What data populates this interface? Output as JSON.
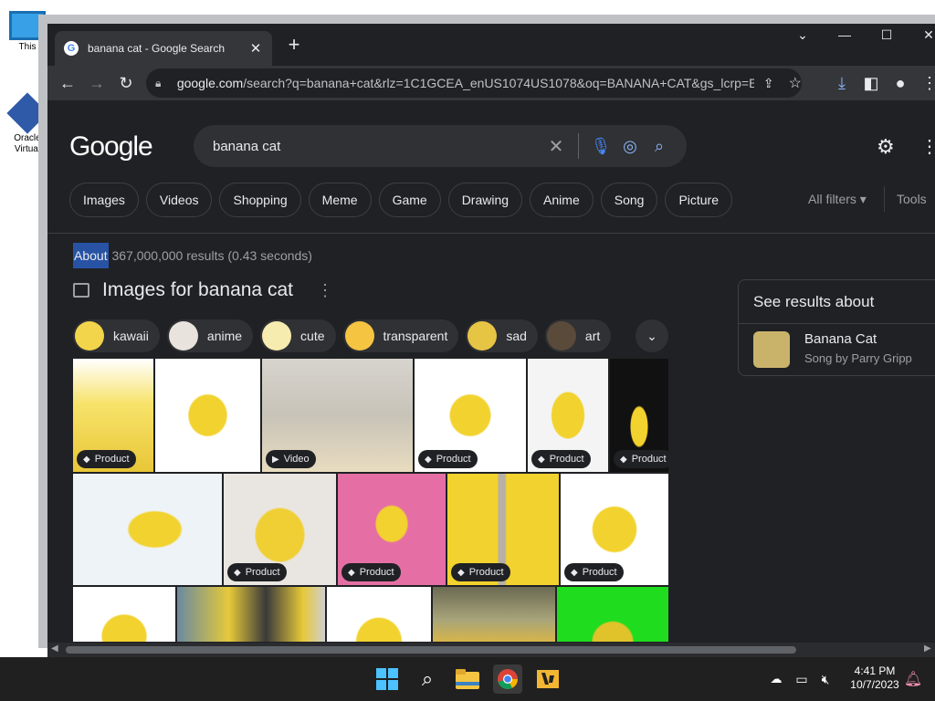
{
  "desktop": {
    "icons": [
      {
        "label": "This"
      },
      {
        "label": "Oracle Virtual"
      }
    ]
  },
  "browser": {
    "tab": {
      "title": "banana cat - Google Search",
      "close": "✕"
    },
    "new_tab": "+",
    "window_controls": {
      "tabsearch": "⌄",
      "minimize": "—",
      "maximize": "☐",
      "close": "✕"
    },
    "url_domain": "google.com",
    "url_path": "/search?q=banana+cat&rlz=1C1GCEA_enUS1074US1078&oq=BANANA+CAT&gs_lcrp=E..."
  },
  "google": {
    "logo": "Google",
    "query": "banana cat",
    "chips": [
      "Images",
      "Videos",
      "Shopping",
      "Meme",
      "Game",
      "Drawing",
      "Anime",
      "Song",
      "Picture"
    ],
    "all_filters": "All filters ▾",
    "tools": "Tools",
    "stats_about": "About",
    "stats_rest": " 367,000,000 results (0.43 seconds)",
    "images_heading": "Images for banana cat",
    "kebab": "⋮",
    "filter_chips": [
      {
        "label": "kawaii",
        "color": "#f2d54a"
      },
      {
        "label": "anime",
        "color": "#e8e3dc"
      },
      {
        "label": "cute",
        "color": "#f7ecb0"
      },
      {
        "label": "transparent",
        "color": "#f5c542"
      },
      {
        "label": "sad",
        "color": "#e6c545"
      },
      {
        "label": "art",
        "color": "#5a4a3a"
      }
    ],
    "badges": {
      "product": "Product",
      "video": "Video"
    },
    "side_panel": {
      "heading": "See results about",
      "name": "Banana Cat",
      "subtitle": "Song by Parry Gripp"
    }
  },
  "taskbar": {
    "time": "4:41 PM",
    "date": "10/7/2023"
  },
  "colors": {
    "accent": "#2853a5",
    "background": "#202124",
    "banana": "#f2d22e"
  }
}
